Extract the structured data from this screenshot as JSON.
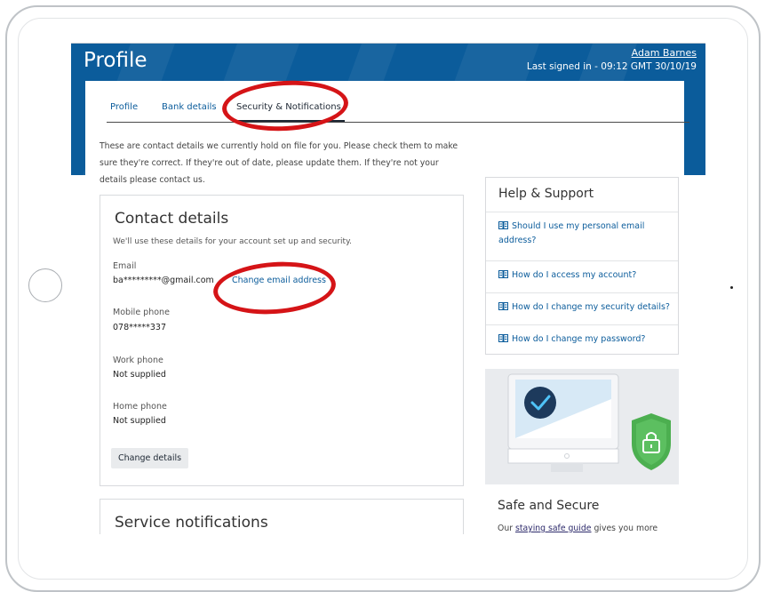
{
  "header": {
    "title": "Profile",
    "user_name": "Adam Barnes",
    "last_signed": "Last signed in - 09:12 GMT 30/10/19"
  },
  "tabs": [
    {
      "label": "Profile"
    },
    {
      "label": "Bank details"
    },
    {
      "label": "Security & Notifications"
    }
  ],
  "intro": "These are contact details we currently hold on file for you. Please check them to make sure they're correct. If they're out of date, please update them. If they're not your details please contact us.",
  "contact": {
    "heading": "Contact details",
    "subtext": "We'll use these details for your account set up and security.",
    "email_label": "Email",
    "email_value": "ba*********@gmail.com",
    "change_email_label": "Change email address",
    "mobile_label": "Mobile phone",
    "mobile_value": "078*****337",
    "work_label": "Work phone",
    "work_value": "Not supplied",
    "home_label": "Home phone",
    "home_value": "Not supplied",
    "change_details_label": "Change details"
  },
  "service": {
    "heading": "Service notifications"
  },
  "help": {
    "heading": "Help & Support",
    "items": [
      {
        "label": "Should I use my personal email address?"
      },
      {
        "label": "How do I access my account?"
      },
      {
        "label": "How do I change my security details?"
      },
      {
        "label": "How do I change my password?"
      }
    ]
  },
  "safe": {
    "heading": "Safe and Secure",
    "text_before": "Our ",
    "link": "staying safe guide",
    "text_after": " gives you more information on how to reduce the risk of identity fraud."
  },
  "colors": {
    "brand_blue": "#0b5c9b",
    "annotation_red": "#d51417",
    "shield_green": "#4caf50"
  },
  "icons": {
    "help_item": "book-icon",
    "device": "monitor-icon",
    "check": "checkmark-icon",
    "shield": "shield-lock-icon"
  }
}
